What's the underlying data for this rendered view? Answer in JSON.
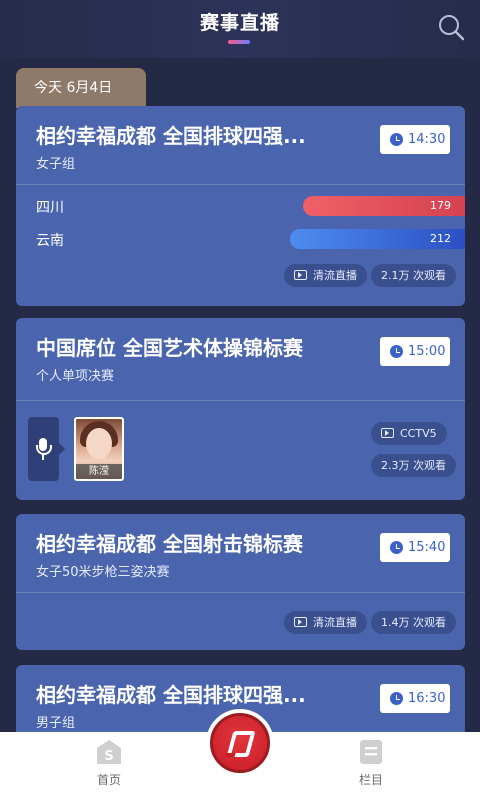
{
  "header": {
    "title": "赛事直播",
    "search_icon": "search-icon"
  },
  "date_tab": "今天 6月4日",
  "cards": [
    {
      "title": "相约幸福成都 全国排球四强...",
      "subtitle": "女子组",
      "time": "14:30",
      "teams": [
        {
          "name": "四川",
          "votes": "179",
          "color": "#e64a55"
        },
        {
          "name": "云南",
          "votes": "212",
          "color": "#3a6fd9"
        }
      ],
      "chips": [
        "清流直播",
        "2.1万 次观看"
      ]
    },
    {
      "title": "中国席位 全国艺术体操锦标赛",
      "subtitle": "个人单项决赛",
      "time": "15:00",
      "commentator": "陈滢",
      "chips": [
        "CCTV5",
        "2.3万 次观看"
      ]
    },
    {
      "title": "相约幸福成都 全国射击锦标赛",
      "subtitle": "女子50米步枪三姿决赛",
      "time": "15:40",
      "chips": [
        "清流直播",
        "1.4万 次观看"
      ]
    },
    {
      "title": "相约幸福成都 全国排球四强...",
      "subtitle": "男子组",
      "time": "16:30"
    }
  ],
  "bottom_nav": {
    "home": "首页",
    "columns": "栏目"
  },
  "colors": {
    "background": "#242a45",
    "card": "#4a64ad",
    "accent_red": "#c81e28",
    "accent_blue": "#3a62c9"
  }
}
